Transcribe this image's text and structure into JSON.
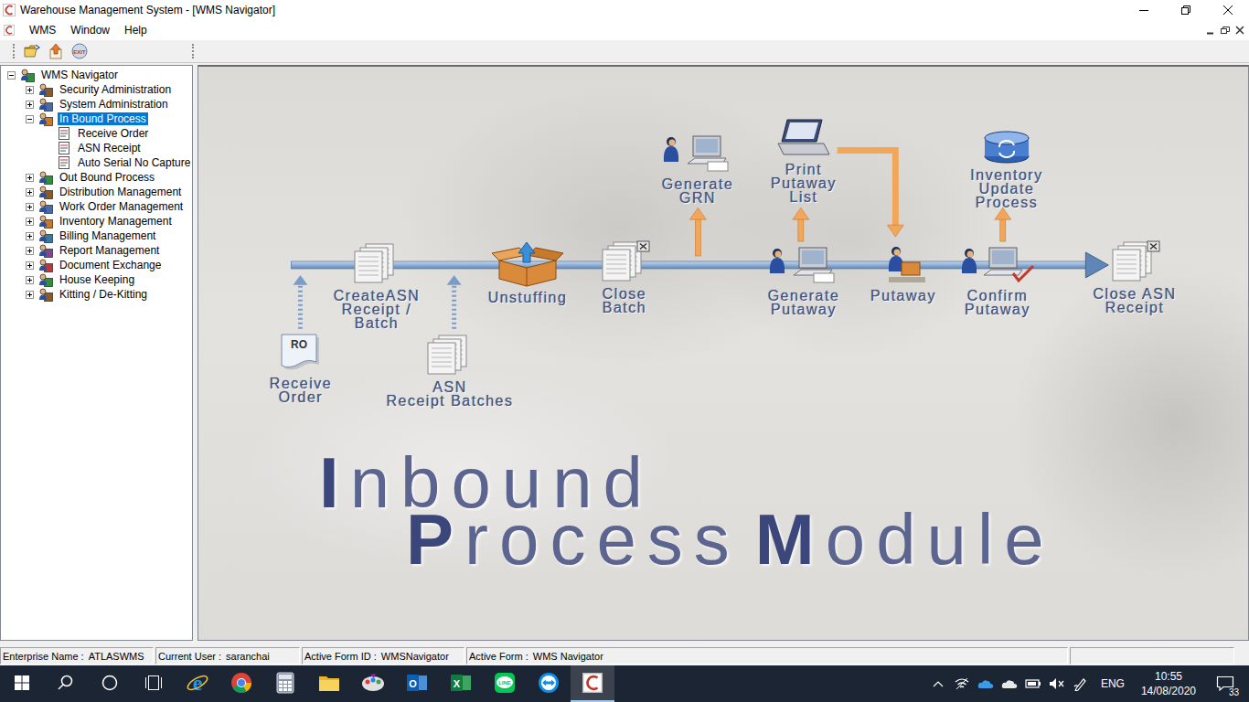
{
  "window": {
    "title": "Warehouse Management System - [WMS Navigator]"
  },
  "menu": [
    {
      "label": "WMS"
    },
    {
      "label": "Window"
    },
    {
      "label": "Help"
    }
  ],
  "toolbar": [
    {
      "kind": "open"
    },
    {
      "kind": "up"
    },
    {
      "kind": "exit",
      "label": "EXIT"
    }
  ],
  "tree": [
    {
      "label": "WMS Navigator",
      "level": 0,
      "expanded": true,
      "selected": false
    },
    {
      "label": "Security Administration",
      "level": 1,
      "expanded": false,
      "selected": false
    },
    {
      "label": "System Administration",
      "level": 1,
      "expanded": false,
      "selected": false
    },
    {
      "label": "In Bound Process",
      "level": 1,
      "expanded": true,
      "selected": true
    },
    {
      "label": "Receive Order",
      "level": 2,
      "selected": false
    },
    {
      "label": "ASN Receipt",
      "level": 2,
      "selected": false
    },
    {
      "label": "Auto Serial No Capture",
      "level": 2,
      "selected": false
    },
    {
      "label": "Out Bound Process",
      "level": 1,
      "expanded": false,
      "selected": false
    },
    {
      "label": "Distribution Management",
      "level": 1,
      "expanded": false,
      "selected": false
    },
    {
      "label": "Work Order Management",
      "level": 1,
      "expanded": false,
      "selected": false
    },
    {
      "label": "Inventory Management",
      "level": 1,
      "expanded": false,
      "selected": false
    },
    {
      "label": "Billing Management",
      "level": 1,
      "expanded": false,
      "selected": false
    },
    {
      "label": "Report Management",
      "level": 1,
      "expanded": false,
      "selected": false
    },
    {
      "label": "Document Exchange",
      "level": 1,
      "expanded": false,
      "selected": false
    },
    {
      "label": "House Keeping",
      "level": 1,
      "expanded": false,
      "selected": false
    },
    {
      "label": "Kitting / De-Kitting",
      "level": 1,
      "expanded": false,
      "selected": false
    }
  ],
  "diagram": {
    "nodes": [
      {
        "kind": "document",
        "badge": "RO",
        "lines": [
          "Receive",
          "Order"
        ]
      },
      {
        "kind": "pages",
        "lines": [
          "CreateASN",
          "Receipt /",
          "Batch"
        ]
      },
      {
        "kind": "pages",
        "lines": [
          "ASN",
          "Receipt Batches"
        ]
      },
      {
        "kind": "box",
        "lines": [
          "Unstuffing"
        ]
      },
      {
        "kind": "closed-pages",
        "lines": [
          "Close",
          "Batch"
        ]
      },
      {
        "kind": "operator",
        "lines": [
          "Generate",
          "GRN"
        ]
      },
      {
        "kind": "printer",
        "lines": [
          "Print",
          "Putaway",
          "List"
        ]
      },
      {
        "kind": "operator",
        "lines": [
          "Generate",
          "Putaway"
        ]
      },
      {
        "kind": "worker",
        "lines": [
          "Putaway"
        ]
      },
      {
        "kind": "confirm",
        "lines": [
          "Confirm",
          "Putaway"
        ]
      },
      {
        "kind": "database",
        "lines": [
          "Inventory",
          "Update",
          "Process"
        ]
      },
      {
        "kind": "closed-pages",
        "lines": [
          "Close ASN",
          "Receipt"
        ]
      }
    ],
    "title_lines": [
      [
        "Inbound"
      ],
      [
        "Process",
        "Module"
      ]
    ]
  },
  "status_bar": [
    {
      "label": "Enterprise Name :",
      "value": "ATLASWMS"
    },
    {
      "label": "Current User :",
      "value": "saranchai"
    },
    {
      "label": "Active Form ID :",
      "value": "WMSNavigator"
    },
    {
      "label": "Active Form :",
      "value": "WMS Navigator"
    }
  ],
  "taskbar": {
    "buttons": [
      {
        "kind": "start"
      },
      {
        "kind": "search"
      },
      {
        "kind": "cortana"
      },
      {
        "kind": "task-view"
      }
    ],
    "apps": [
      {
        "kind": "ie",
        "glyph": "e",
        "active": false
      },
      {
        "kind": "chrome",
        "active": false
      },
      {
        "kind": "calculator",
        "active": false
      },
      {
        "kind": "explorer",
        "active": false
      },
      {
        "kind": "paint",
        "active": false
      },
      {
        "kind": "outlook",
        "glyph": "O",
        "active": false
      },
      {
        "kind": "excel",
        "glyph": "X",
        "active": false
      },
      {
        "kind": "line",
        "glyph": "LINE",
        "active": false
      },
      {
        "kind": "teamviewer",
        "active": false
      },
      {
        "kind": "wms",
        "active": true
      }
    ],
    "tray": {
      "icons": [
        {
          "kind": "chevron"
        },
        {
          "kind": "wifi"
        },
        {
          "kind": "onedrive"
        },
        {
          "kind": "cloud"
        },
        {
          "kind": "battery"
        },
        {
          "kind": "muted-speaker"
        },
        {
          "kind": "pen"
        }
      ],
      "language": "ENG",
      "time": "10:55",
      "date": "14/08/2020",
      "notifications": "33"
    }
  }
}
